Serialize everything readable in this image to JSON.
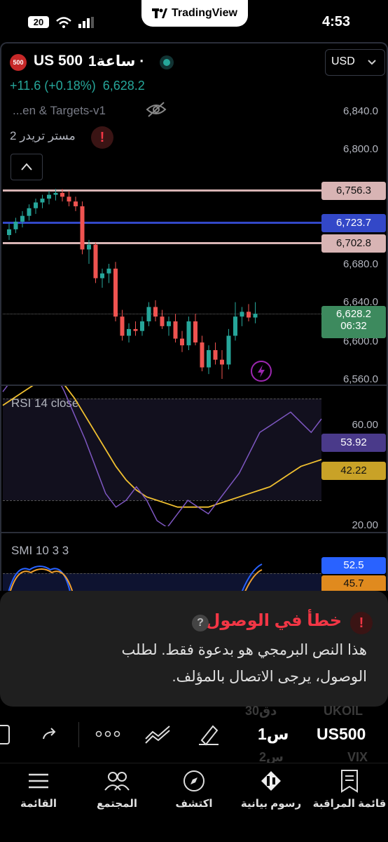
{
  "status": {
    "time": "4:53",
    "battery": "20"
  },
  "app_name": "TradingView",
  "header": {
    "symbol": "US 500",
    "symbol_badge": "500",
    "timeframe": "1ساعة ·",
    "currency": "USD",
    "change": "+11.6 (+0.18%)",
    "last_price": "6,628.2",
    "indicator_name": "...en & Targets-v1",
    "script_name": "مستر تريدر 2"
  },
  "price_axis": {
    "labels": [
      "6,840.0",
      "6,800.0",
      "6,680.0",
      "6,640.0",
      "6,600.0",
      "6,560.0"
    ],
    "tags": [
      {
        "value": "6,756.3",
        "color": "#d8b4b4"
      },
      {
        "value": "6,723.7",
        "color": "#3348c8"
      },
      {
        "value": "6,702.8",
        "color": "#d8b4b4"
      },
      {
        "value": "6,628.2",
        "color": "#3d8a5e"
      }
    ],
    "countdown": "06:32"
  },
  "rsi": {
    "label": "RSI 14 close",
    "axis": [
      "60.00",
      "20.00"
    ],
    "value_rsi": "53.92",
    "value_ma": "42.22",
    "colors": {
      "rsi": "#7e57c2",
      "ma": "#f0c030"
    }
  },
  "smi": {
    "label": "SMI 10 3 3",
    "value_1": "52.5",
    "value_2": "45.7"
  },
  "alert": {
    "title": "خطأ في الوصول",
    "body_line1": "هذا النص البرمجي هو بدعوة فقط. لطلب",
    "body_line2": "الوصول، يرجى الاتصال بالمؤلف."
  },
  "toolbar": {
    "symbol": "US500",
    "interval": "1س",
    "behind_top": "UKOIL",
    "behind_top_2": "30دق",
    "behind_bottom": "VIX",
    "behind_bottom_2": "2س"
  },
  "nav": [
    {
      "label": "قائمة المراقبة",
      "icon": "watchlist-icon"
    },
    {
      "label": "رسوم بيانية",
      "icon": "charts-icon"
    },
    {
      "label": "اكتشف",
      "icon": "explore-icon"
    },
    {
      "label": "المجتمع",
      "icon": "community-icon"
    },
    {
      "label": "القائمة",
      "icon": "menu-icon"
    }
  ],
  "chart_data": {
    "type": "candlestick",
    "ylim": [
      6550,
      6860
    ],
    "candles": [
      [
        6710,
        6722,
        6705,
        6716
      ],
      [
        6716,
        6728,
        6712,
        6724
      ],
      [
        6724,
        6735,
        6718,
        6730
      ],
      [
        6730,
        6742,
        6725,
        6738
      ],
      [
        6738,
        6748,
        6732,
        6744
      ],
      [
        6744,
        6752,
        6738,
        6748
      ],
      [
        6748,
        6756,
        6742,
        6752
      ],
      [
        6752,
        6758,
        6746,
        6754
      ],
      [
        6754,
        6758,
        6745,
        6750
      ],
      [
        6750,
        6756,
        6740,
        6745
      ],
      [
        6745,
        6750,
        6735,
        6740
      ],
      [
        6740,
        6745,
        6690,
        6695
      ],
      [
        6695,
        6705,
        6680,
        6700
      ],
      [
        6700,
        6702,
        6660,
        6665
      ],
      [
        6665,
        6675,
        6655,
        6670
      ],
      [
        6670,
        6680,
        6660,
        6675
      ],
      [
        6675,
        6682,
        6620,
        6625
      ],
      [
        6625,
        6632,
        6600,
        6605
      ],
      [
        6605,
        6618,
        6598,
        6612
      ],
      [
        6612,
        6620,
        6605,
        6610
      ],
      [
        6610,
        6625,
        6605,
        6620
      ],
      [
        6620,
        6640,
        6615,
        6635
      ],
      [
        6635,
        6642,
        6620,
        6625
      ],
      [
        6625,
        6632,
        6612,
        6615
      ],
      [
        6615,
        6625,
        6605,
        6620
      ],
      [
        6620,
        6628,
        6598,
        6602
      ],
      [
        6602,
        6610,
        6588,
        6595
      ],
      [
        6595,
        6625,
        6590,
        6620
      ],
      [
        6620,
        6628,
        6595,
        6598
      ],
      [
        6598,
        6605,
        6568,
        6572
      ],
      [
        6572,
        6595,
        6565,
        6590
      ],
      [
        6590,
        6598,
        6575,
        6580
      ],
      [
        6580,
        6590,
        6560,
        6575
      ],
      [
        6575,
        6612,
        6570,
        6605
      ],
      [
        6605,
        6640,
        6600,
        6625
      ],
      [
        6625,
        6635,
        6615,
        6630
      ],
      [
        6630,
        6638,
        6620,
        6624
      ],
      [
        6624,
        6640,
        6618,
        6628
      ]
    ],
    "rsi_values": [
      62,
      66,
      70,
      72,
      71,
      68,
      62,
      55,
      48,
      40,
      32,
      28,
      30,
      34,
      30,
      24,
      22,
      26,
      30,
      28,
      26,
      30,
      34,
      38,
      44,
      50,
      52,
      54,
      56,
      53,
      50,
      54
    ],
    "rsi_ma_values": [
      58,
      60,
      62,
      64,
      66,
      66,
      64,
      60,
      55,
      50,
      45,
      40,
      36,
      33,
      31,
      30,
      29,
      28,
      28,
      28,
      28,
      29,
      30,
      31,
      32,
      33,
      34,
      36,
      38,
      40,
      41,
      42
    ]
  }
}
